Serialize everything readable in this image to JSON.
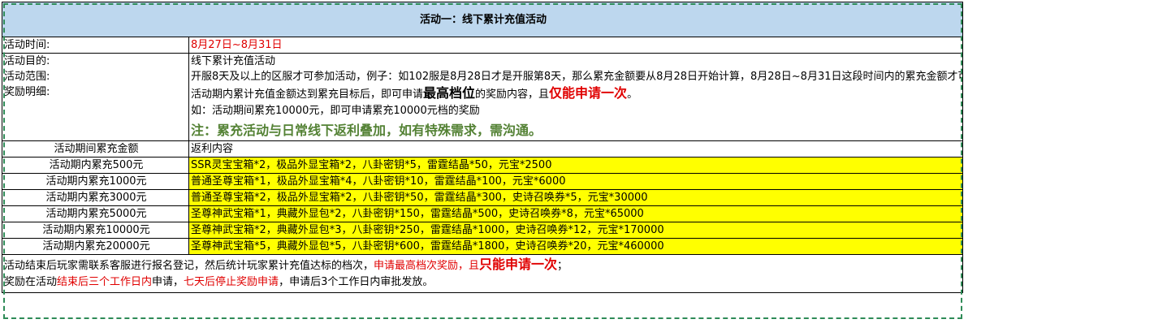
{
  "title": "活动一：线下累计充值活动",
  "info": {
    "time_label": "活动时间:",
    "time_value": "8月27日~8月31日",
    "labels": [
      "活动目的:",
      "活动范围:",
      "奖励明细:"
    ],
    "purpose": "线下累计充值活动",
    "scope": "开服8天及以上的区服才可参加活动，例子：如102服是8月28日才是开服第8天，那么累充金额要从8月28日开始计算，8月28日~8月31日这段时间内的累充金额才可参与到活动内。",
    "detail_a": "活动期内累计充值金额达到累充目标后，即可申请",
    "detail_b": "最高档位",
    "detail_c": "的奖励内容，且",
    "detail_d": "仅能申请一次",
    "detail_e": "。",
    "example": "如：活动期间累充10000元，即可申请累充10000元档的奖励",
    "note": "注：累充活动与日常线下返利叠加，如有特殊需求，需沟通。"
  },
  "table": {
    "header_amount": "活动期间累充金额",
    "header_reward": "返利内容",
    "rows": [
      {
        "tier": "活动期内累充500元",
        "reward": "SSR灵宝宝箱*2，极品外显宝箱*2，八卦密钥*5，雷霆结晶*50，元宝*2500"
      },
      {
        "tier": "活动期内累充1000元",
        "reward": "普通圣尊宝箱*1，极品外显宝箱*4，八卦密钥*10，雷霆结晶*100，元宝*6000"
      },
      {
        "tier": "活动期内累充3000元",
        "reward": "普通圣尊宝箱*2，极品外显宝箱*2，八卦密钥*50，雷霆结晶*300，史诗召唤券*5，元宝*30000"
      },
      {
        "tier": "活动期内累充5000元",
        "reward": "圣尊神武宝箱*1，典藏外显包*2，八卦密钥*150，雷霆结晶*500，史诗召唤券*8，元宝*65000"
      },
      {
        "tier": "活动期内累充10000元",
        "reward": "圣尊神武宝箱*2，典藏外显包*3，八卦密钥*250，雷霆结晶*1000，史诗召唤券*12，元宝*170000"
      },
      {
        "tier": "活动期内累充20000元",
        "reward": "圣尊神武宝箱*5，典藏外显包*5，八卦密钥*600，雷霆结晶*1800，史诗召唤券*20，元宝*460000"
      }
    ]
  },
  "footer": {
    "line1_a": "活动结束后玩家需联系客服进行报名登记，然后统计玩家累计充值达标的档次，",
    "line1_b": "申请最高档次奖励，且",
    "line1_c": "只能申请一次",
    "line1_d": "；",
    "line2_a": "奖励在活动",
    "line2_b": "结束后三个工作日内",
    "line2_c": "申请，",
    "line2_d": "七天后停止奖励申请",
    "line2_e": "，申请后3个工作日内审批发放。"
  },
  "colors": {
    "title_bg": "#bdd7ee",
    "highlight_bg": "#ffff00",
    "accent_red": "#e00000",
    "note_green": "#548235",
    "frame_green": "#2e8b57"
  }
}
